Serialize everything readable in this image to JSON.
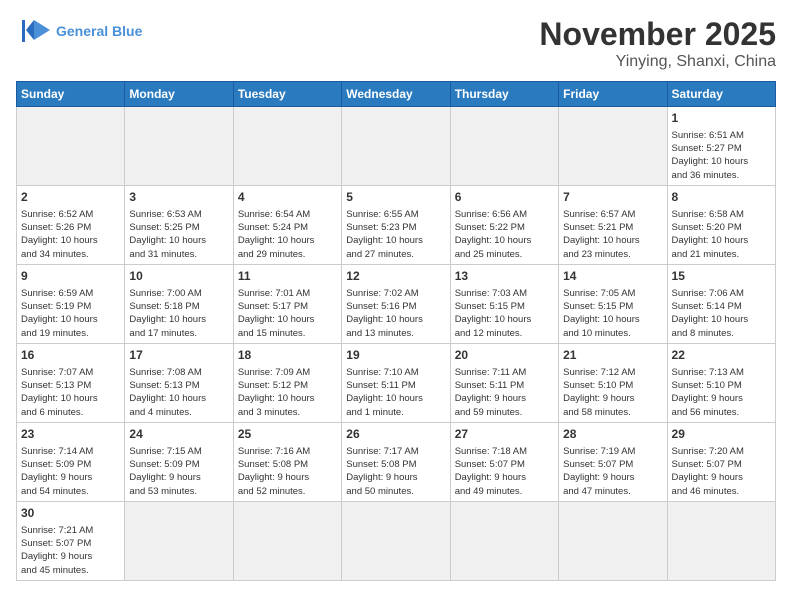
{
  "header": {
    "logo_general": "General",
    "logo_blue": "Blue",
    "month_title": "November 2025",
    "location": "Yinying, Shanxi, China"
  },
  "weekdays": [
    "Sunday",
    "Monday",
    "Tuesday",
    "Wednesday",
    "Thursday",
    "Friday",
    "Saturday"
  ],
  "weeks": [
    [
      {
        "day": "",
        "info": "",
        "shade": true
      },
      {
        "day": "",
        "info": "",
        "shade": true
      },
      {
        "day": "",
        "info": "",
        "shade": true
      },
      {
        "day": "",
        "info": "",
        "shade": true
      },
      {
        "day": "",
        "info": "",
        "shade": true
      },
      {
        "day": "",
        "info": "",
        "shade": true
      },
      {
        "day": "1",
        "info": "Sunrise: 6:51 AM\nSunset: 5:27 PM\nDaylight: 10 hours\nand 36 minutes."
      }
    ],
    [
      {
        "day": "2",
        "info": "Sunrise: 6:52 AM\nSunset: 5:26 PM\nDaylight: 10 hours\nand 34 minutes."
      },
      {
        "day": "3",
        "info": "Sunrise: 6:53 AM\nSunset: 5:25 PM\nDaylight: 10 hours\nand 31 minutes."
      },
      {
        "day": "4",
        "info": "Sunrise: 6:54 AM\nSunset: 5:24 PM\nDaylight: 10 hours\nand 29 minutes."
      },
      {
        "day": "5",
        "info": "Sunrise: 6:55 AM\nSunset: 5:23 PM\nDaylight: 10 hours\nand 27 minutes."
      },
      {
        "day": "6",
        "info": "Sunrise: 6:56 AM\nSunset: 5:22 PM\nDaylight: 10 hours\nand 25 minutes."
      },
      {
        "day": "7",
        "info": "Sunrise: 6:57 AM\nSunset: 5:21 PM\nDaylight: 10 hours\nand 23 minutes."
      },
      {
        "day": "8",
        "info": "Sunrise: 6:58 AM\nSunset: 5:20 PM\nDaylight: 10 hours\nand 21 minutes."
      }
    ],
    [
      {
        "day": "9",
        "info": "Sunrise: 6:59 AM\nSunset: 5:19 PM\nDaylight: 10 hours\nand 19 minutes."
      },
      {
        "day": "10",
        "info": "Sunrise: 7:00 AM\nSunset: 5:18 PM\nDaylight: 10 hours\nand 17 minutes."
      },
      {
        "day": "11",
        "info": "Sunrise: 7:01 AM\nSunset: 5:17 PM\nDaylight: 10 hours\nand 15 minutes."
      },
      {
        "day": "12",
        "info": "Sunrise: 7:02 AM\nSunset: 5:16 PM\nDaylight: 10 hours\nand 13 minutes."
      },
      {
        "day": "13",
        "info": "Sunrise: 7:03 AM\nSunset: 5:15 PM\nDaylight: 10 hours\nand 12 minutes."
      },
      {
        "day": "14",
        "info": "Sunrise: 7:05 AM\nSunset: 5:15 PM\nDaylight: 10 hours\nand 10 minutes."
      },
      {
        "day": "15",
        "info": "Sunrise: 7:06 AM\nSunset: 5:14 PM\nDaylight: 10 hours\nand 8 minutes."
      }
    ],
    [
      {
        "day": "16",
        "info": "Sunrise: 7:07 AM\nSunset: 5:13 PM\nDaylight: 10 hours\nand 6 minutes."
      },
      {
        "day": "17",
        "info": "Sunrise: 7:08 AM\nSunset: 5:13 PM\nDaylight: 10 hours\nand 4 minutes."
      },
      {
        "day": "18",
        "info": "Sunrise: 7:09 AM\nSunset: 5:12 PM\nDaylight: 10 hours\nand 3 minutes."
      },
      {
        "day": "19",
        "info": "Sunrise: 7:10 AM\nSunset: 5:11 PM\nDaylight: 10 hours\nand 1 minute."
      },
      {
        "day": "20",
        "info": "Sunrise: 7:11 AM\nSunset: 5:11 PM\nDaylight: 9 hours\nand 59 minutes."
      },
      {
        "day": "21",
        "info": "Sunrise: 7:12 AM\nSunset: 5:10 PM\nDaylight: 9 hours\nand 58 minutes."
      },
      {
        "day": "22",
        "info": "Sunrise: 7:13 AM\nSunset: 5:10 PM\nDaylight: 9 hours\nand 56 minutes."
      }
    ],
    [
      {
        "day": "23",
        "info": "Sunrise: 7:14 AM\nSunset: 5:09 PM\nDaylight: 9 hours\nand 54 minutes."
      },
      {
        "day": "24",
        "info": "Sunrise: 7:15 AM\nSunset: 5:09 PM\nDaylight: 9 hours\nand 53 minutes."
      },
      {
        "day": "25",
        "info": "Sunrise: 7:16 AM\nSunset: 5:08 PM\nDaylight: 9 hours\nand 52 minutes."
      },
      {
        "day": "26",
        "info": "Sunrise: 7:17 AM\nSunset: 5:08 PM\nDaylight: 9 hours\nand 50 minutes."
      },
      {
        "day": "27",
        "info": "Sunrise: 7:18 AM\nSunset: 5:07 PM\nDaylight: 9 hours\nand 49 minutes."
      },
      {
        "day": "28",
        "info": "Sunrise: 7:19 AM\nSunset: 5:07 PM\nDaylight: 9 hours\nand 47 minutes."
      },
      {
        "day": "29",
        "info": "Sunrise: 7:20 AM\nSunset: 5:07 PM\nDaylight: 9 hours\nand 46 minutes."
      }
    ],
    [
      {
        "day": "30",
        "info": "Sunrise: 7:21 AM\nSunset: 5:07 PM\nDaylight: 9 hours\nand 45 minutes."
      },
      {
        "day": "",
        "info": "",
        "shade": true
      },
      {
        "day": "",
        "info": "",
        "shade": true
      },
      {
        "day": "",
        "info": "",
        "shade": true
      },
      {
        "day": "",
        "info": "",
        "shade": true
      },
      {
        "day": "",
        "info": "",
        "shade": true
      },
      {
        "day": "",
        "info": "",
        "shade": true
      }
    ]
  ]
}
